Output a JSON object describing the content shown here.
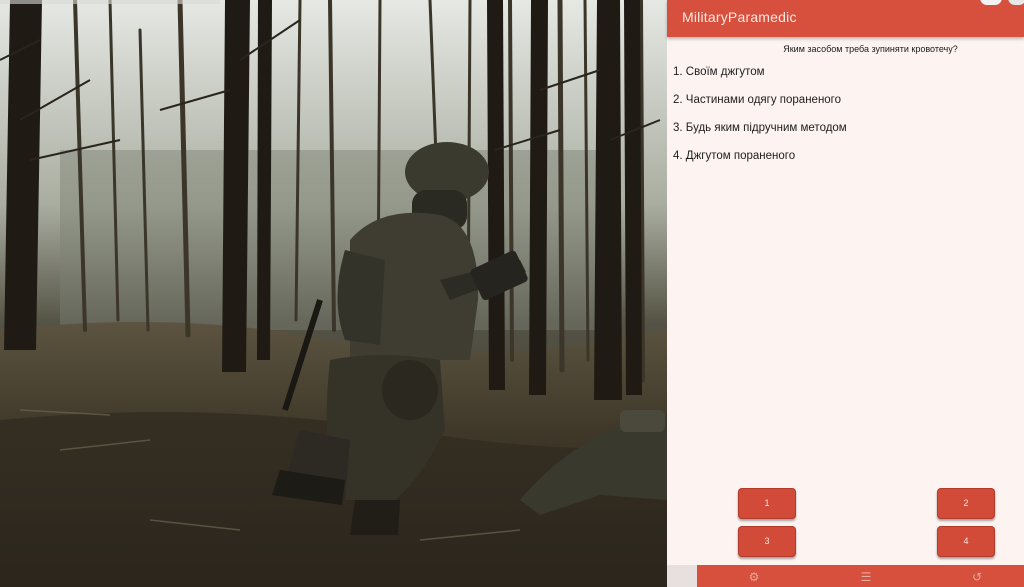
{
  "app": {
    "title": "MilitaryParamedic",
    "accent_color": "#d6503d",
    "background_color": "#fdf3f1"
  },
  "quiz": {
    "question": "Яким засобом треба зупиняти кровотечу?",
    "answers": [
      "1. Своїм джгутом",
      "2. Частинами одягу пораненого",
      "3. Будь яким підручним методом",
      "4. Джгутом пораненого"
    ],
    "buttons": [
      "1",
      "2",
      "3",
      "4"
    ]
  },
  "bottom_nav": {
    "icons": [
      "gear-icon",
      "list-icon",
      "history-icon"
    ]
  },
  "scene": {
    "description_icons": [
      "forest-video-frame"
    ]
  }
}
